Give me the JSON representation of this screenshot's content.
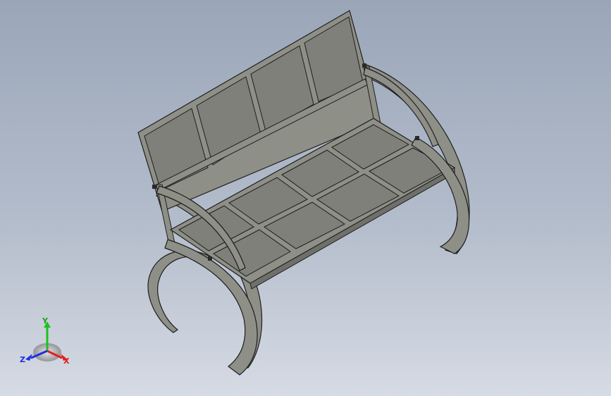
{
  "viewport": {
    "background_top": "#9aa6b8",
    "background_bottom": "#d6dbe4"
  },
  "model": {
    "object": "bench-3d-model",
    "panel_fill": "#7f807a",
    "frame_fill": "#8e8f87",
    "edge_color": "#1e1e1e"
  },
  "triad": {
    "x_label": "X",
    "y_label": "Y",
    "z_label": "Z",
    "x_color": "#e02020",
    "y_color": "#20c020",
    "z_color": "#2030e0"
  }
}
